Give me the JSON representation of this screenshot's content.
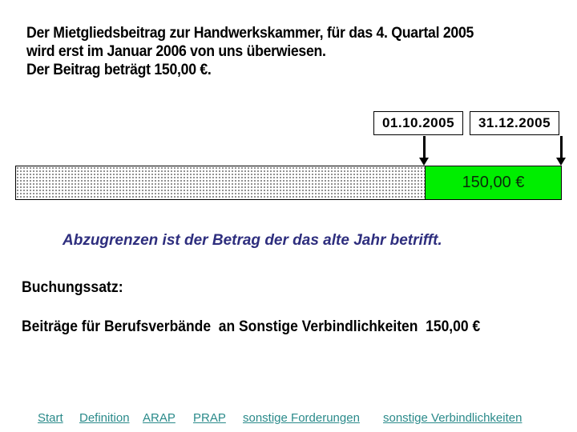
{
  "intro": {
    "lines": [
      "Der Mietgliedsbeitrag zur Handwerkskammer, für das 4. Quartal 2005",
      "wird erst im Januar 2006 von uns überwiesen.",
      "Der Beitrag beträgt 150,00 €."
    ]
  },
  "timeline": {
    "start_date": "01.10.2005",
    "end_date": "31.12.2005",
    "amount_label": "150,00 €",
    "colors": {
      "current_period": "#00ee00",
      "amount_text": "#0a2a0a"
    }
  },
  "note": "Abzugrenzen ist der Betrag der das alte Jahr betrifft.",
  "booking": {
    "heading": "Buchungssatz:",
    "entry": "Beiträge für Berufsverbände  an Sonstige Verbindlichkeiten  150,00 €"
  },
  "nav": {
    "links": [
      "Start",
      "Definition",
      "ARAP",
      "PRAP",
      "sonstige Forderungen",
      "sonstige Verbindlichkeiten"
    ],
    "color": "#2a8a8a"
  },
  "colors": {
    "note_text": "#2e2e7e"
  }
}
